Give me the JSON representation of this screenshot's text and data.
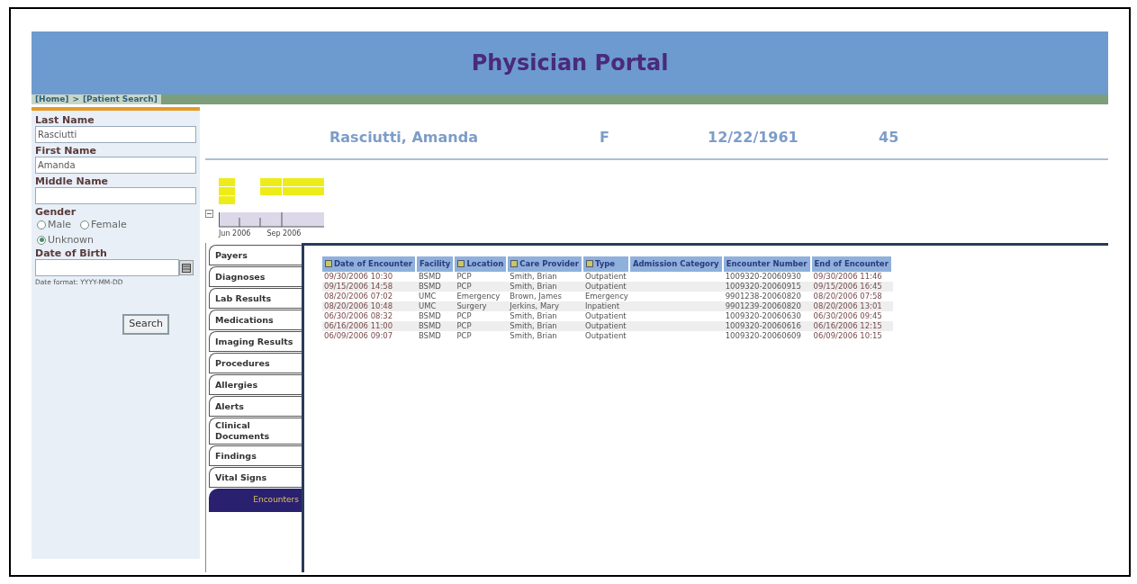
{
  "header": {
    "title": "Physician Portal"
  },
  "breadcrumb": [
    {
      "label": "[Home]"
    },
    {
      "label": ">"
    },
    {
      "label": "[Patient Search]"
    }
  ],
  "search_form": {
    "last_name": {
      "label": "Last Name",
      "value": "Rasciutti"
    },
    "first_name": {
      "label": "First Name",
      "value": "Amanda"
    },
    "middle_name": {
      "label": "Middle Name"
    },
    "gender": {
      "label": "Gender",
      "options": [
        {
          "label": "Male",
          "selected": false
        },
        {
          "label": "Female",
          "selected": false
        },
        {
          "label": "Unknown",
          "selected": true
        }
      ]
    },
    "date_of_birth": {
      "label": "Date of Birth",
      "hint": "Date format: YYYY-MM-DD"
    },
    "button": "Search"
  },
  "patient": {
    "name": "Rasciutti, Amanda",
    "sex": "F",
    "birth_date": "12/22/1961",
    "age": "45"
  },
  "timeline": {
    "labels": [
      "Jun 2006",
      "Sep 2006"
    ]
  },
  "tabs": [
    {
      "label": "Payers",
      "selected": false
    },
    {
      "label": "Diagnoses",
      "selected": false
    },
    {
      "label": "Lab Results",
      "selected": false
    },
    {
      "label": "Medications",
      "selected": false
    },
    {
      "label": "Imaging Results",
      "selected": false
    },
    {
      "label": "Procedures",
      "selected": false
    },
    {
      "label": "Allergies",
      "selected": false
    },
    {
      "label": "Alerts",
      "selected": false
    },
    {
      "label": "Clinical Documents",
      "selected": false
    },
    {
      "label": "Findings",
      "selected": false
    },
    {
      "label": "Vital Signs",
      "selected": false
    },
    {
      "label": "Encounters",
      "selected": true
    }
  ],
  "table": {
    "columns": [
      {
        "label": "Date of Encounter",
        "sortable": true
      },
      {
        "label": "Facility",
        "sortable": false
      },
      {
        "label": "Location",
        "sortable": true
      },
      {
        "label": "Care Provider",
        "sortable": true
      },
      {
        "label": "Type",
        "sortable": true
      },
      {
        "label": "Admission Category",
        "sortable": false
      },
      {
        "label": "Encounter Number",
        "sortable": false
      },
      {
        "label": "End of Encounter",
        "sortable": false
      }
    ],
    "rows": [
      [
        "09/30/2006 10:30",
        "BSMD",
        "PCP",
        "Smith, Brian",
        "Outpatient",
        null,
        "1009320-20060930",
        "09/30/2006 11:46"
      ],
      [
        "09/15/2006 14:58",
        "BSMD",
        "PCP",
        "Smith, Brian",
        "Outpatient",
        null,
        "1009320-20060915",
        "09/15/2006 16:45"
      ],
      [
        "08/20/2006 07:02",
        "UMC",
        "Emergency",
        "Brown, James",
        "Emergency",
        null,
        "9901238-20060820",
        "08/20/2006 07:58"
      ],
      [
        "08/20/2006 10:48",
        "UMC",
        "Surgery",
        "Jerkins, Mary",
        "Inpatient",
        null,
        "9901239-20060820",
        "08/20/2006 13:01"
      ],
      [
        "06/30/2006 08:32",
        "BSMD",
        "PCP",
        "Smith, Brian",
        "Outpatient",
        null,
        "1009320-20060630",
        "06/30/2006 09:45"
      ],
      [
        "06/16/2006 11:00",
        "BSMD",
        "PCP",
        "Smith, Brian",
        "Outpatient",
        null,
        "1009320-20060616",
        "06/16/2006 12:15"
      ],
      [
        "06/09/2006 09:07",
        "BSMD",
        "PCP",
        "Smith, Brian",
        "Outpatient",
        null,
        "1009320-20060609",
        "06/09/2006 10:15"
      ]
    ]
  }
}
